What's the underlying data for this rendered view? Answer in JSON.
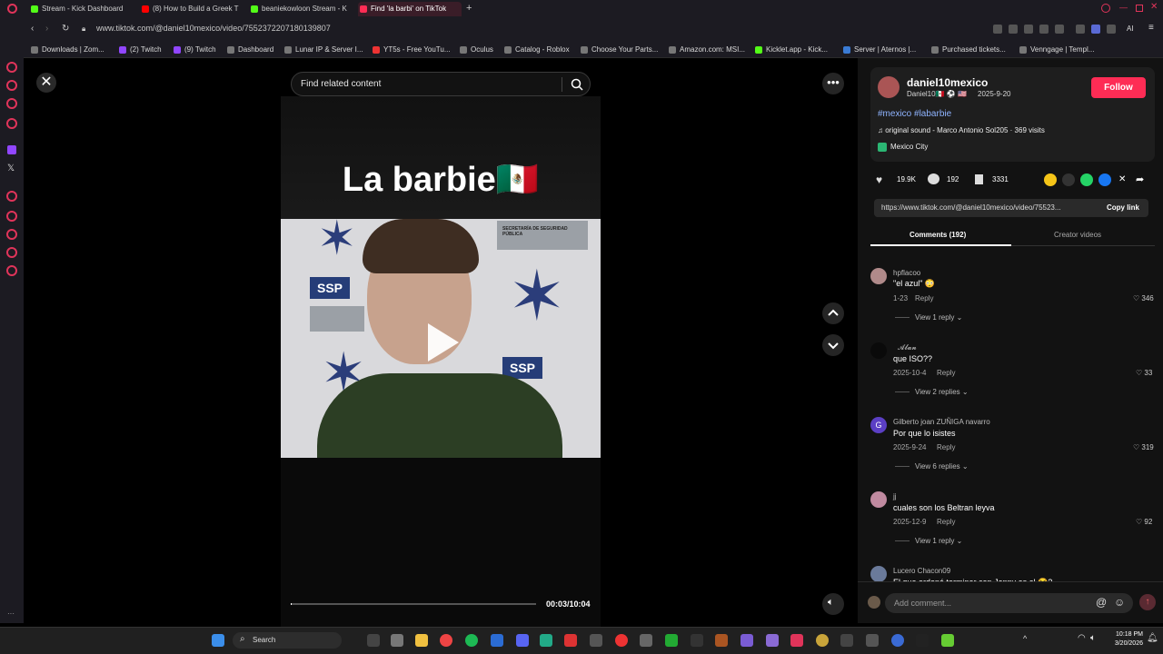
{
  "browser": {
    "tabs": [
      {
        "label": "Stream - Kick Dashboard",
        "color": "#53fc18"
      },
      {
        "label": "(8) How to Build a Greek T",
        "color": "#ff0000"
      },
      {
        "label": "beaniekowloon Stream - K",
        "color": "#53fc18"
      },
      {
        "label": "Find 'la barbi' on TikTok",
        "color": "#ff2d55"
      }
    ],
    "url": "www.tiktok.com/@daniel10mexico/video/7552372207180139807",
    "bookmarks": [
      "Downloads | Zom...",
      "(2) Twitch",
      "(9) Twitch",
      "Dashboard",
      "Lunar IP & Server I...",
      "YT5s - Free YouTu...",
      "Oculus",
      "Catalog - Roblox",
      "Choose Your Parts...",
      "Amazon.com: MSI...",
      "Kicklet.app - Kick...",
      "Server | Aternos |...",
      "Purchased tickets...",
      "Venngage | Templ..."
    ],
    "ai_label": "AI"
  },
  "search": {
    "placeholder": "Find related content"
  },
  "video": {
    "title": "La barbie🇲🇽",
    "ssp_label": "SSP",
    "ssp_label2": "SSP",
    "sign_text": "SECRETARÍA DE SEGURIDAD PÚBLICA",
    "time": "00:03/10:04",
    "progress_fraction": 0.005
  },
  "post": {
    "username": "daniel10mexico",
    "display_name": "Daniel10🇲🇽 ⚽ 🇺🇸",
    "date": "2025-9-20",
    "follow_label": "Follow",
    "tags": "#mexico #labarbie",
    "sound": "original sound - Marco Antonio Sol205 · 369 visits",
    "location": "Mexico City",
    "likes": "19.9K",
    "comments_count": "192",
    "saves": "3331",
    "link": "https://www.tiktok.com/@daniel10mexico/video/75523...",
    "copy_label": "Copy link"
  },
  "panel_tabs": {
    "comments": "Comments (192)",
    "creator": "Creator videos"
  },
  "comments": [
    {
      "user": "hpflacoo",
      "text": "\"el azul\" 😳",
      "date": "1-23",
      "reply": "Reply",
      "likes": "346",
      "view": "View 1 reply",
      "avatar_color": "#b08a8a"
    },
    {
      "user": "𝓐𝓵𝓪𝓷",
      "text": "que ISO??",
      "date": "2025-10-4",
      "reply": "Reply",
      "likes": "33",
      "view": "View 2 replies",
      "avatar_color": "#0a0a0a"
    },
    {
      "user": "Gilberto joan ZUÑIGA navarro",
      "text": "Por que lo isistes",
      "date": "2025-9-24",
      "reply": "Reply",
      "likes": "319",
      "view": "View 6 replies",
      "avatar_color": "#5b3fc4",
      "initial": "G"
    },
    {
      "user": "jj",
      "text": "cuales son los Beltran leyva",
      "date": "2025-12-9",
      "reply": "Reply",
      "likes": "92",
      "view": "View 1 reply",
      "avatar_color": "#c08aa0"
    },
    {
      "user": "Lucero Chacon09",
      "text": "El que ordenó terminar con Jenny es el 😂?",
      "avatar_color": "#6a7a9a"
    }
  ],
  "comment_input": {
    "placeholder": "Add comment..."
  },
  "taskbar": {
    "search_label": "Search",
    "time": "10:18 PM",
    "date": "3/20/2026"
  }
}
